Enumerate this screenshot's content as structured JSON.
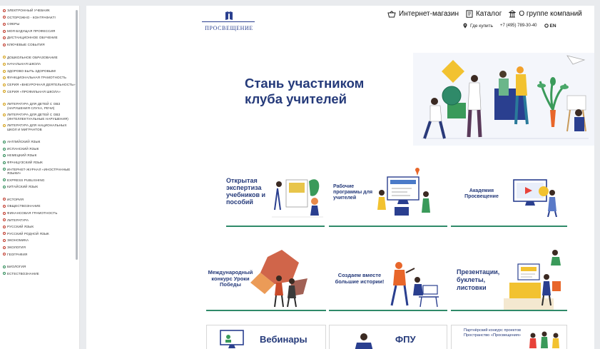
{
  "sidebar": {
    "groups": [
      {
        "dot_color": "#c0392b",
        "items": [
          "Электронный учебник",
          "Осторожно - контрафакт!",
          "Сферы",
          "Моя будущая профессия",
          "Дистанционное обучение",
          "Ключевые события"
        ]
      },
      {
        "dot_color": "#d4a015",
        "items": [
          "Дошкольное образование",
          "Начальная школа",
          "Здорово быть здоровым!",
          "Функциональная грамотность",
          "Серия «Внеурочная деятельность»",
          "Серия «Профильная школа»"
        ]
      },
      {
        "dot_color": "#d4a015",
        "items": [
          "Литература для детей с ОВЗ (нарушения слуха, речи)",
          "Литература для детей с ОВЗ (интеллектуальные нарушения)",
          "Литература для национальных школ и мигрантов"
        ]
      },
      {
        "dot_color": "#2e8b57",
        "items": [
          "Английский язык",
          "Испанский язык",
          "Немецкий язык",
          "Французский язык",
          "Интернет-журнал «Иностранные языки»",
          "Express Publishing",
          "Китайский язык"
        ]
      },
      {
        "dot_color": "#c0392b",
        "items": [
          "История",
          "Обществознание",
          "Финансовая грамотность",
          "Литература",
          "Русский язык",
          "Русский родной язык",
          "Экономика",
          "Экология",
          "География"
        ]
      },
      {
        "dot_color": "#2e8b57",
        "items": [
          "Биология",
          "Естествознание"
        ]
      }
    ]
  },
  "header": {
    "logo_name": "ПРОСВЕЩЕНИЕ",
    "nav": {
      "shop": "Интернет-магазин",
      "catalog": "Каталог",
      "about": "О группе компаний"
    },
    "where_to_buy": "Где купить",
    "phone": "+7 (495) 789-30-40",
    "lang": "EN"
  },
  "hero": {
    "title_line1": "Стань участником",
    "title_line2": "клуба учителей"
  },
  "cards": [
    {
      "title": "Открытая экспертиза учебников и пособий"
    },
    {
      "title": "Рабочие программы для учителей"
    },
    {
      "title": "Академия Просвещение"
    },
    {
      "title": "Международный конкурс Уроки Победы"
    },
    {
      "title": "Создаем вместе большие истории!"
    },
    {
      "title": "Презентации, буклеты, листовки"
    }
  ],
  "cards_row3": [
    {
      "title": "Вебинары"
    },
    {
      "title": "ФПУ"
    },
    {
      "title": "Партнёрский конкурс проектов Пространство «Просвещения»"
    }
  ],
  "colors": {
    "brand_blue": "#253a7a",
    "accent_green": "#2f8a69",
    "accent_red": "#c0392b"
  }
}
